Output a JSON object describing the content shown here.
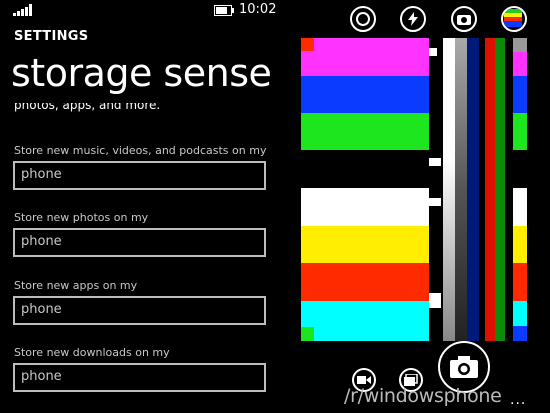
{
  "status_bar": {
    "time": "10:02",
    "signal_icon": "signal-bars-icon",
    "battery_icon": "battery-icon"
  },
  "settings": {
    "app_title": "SETTINGS",
    "page_title": "storage sense",
    "intro_text": "photos, apps, and more.",
    "options": [
      {
        "label": "Store new music, videos, and podcasts on my",
        "value": "phone"
      },
      {
        "label": "Store new photos on my",
        "value": "phone"
      },
      {
        "label": "Store new apps on my",
        "value": "phone"
      },
      {
        "label": "Store new downloads on my",
        "value": "phone"
      }
    ]
  },
  "camera": {
    "top_buttons": [
      "lens-icon",
      "flash-icon",
      "front-camera-icon",
      "color-effects-icon"
    ],
    "bottom_buttons": [
      "video-icon",
      "photo-roll-icon",
      "shutter-camera-icon"
    ],
    "watermark": "/r/windowsphone",
    "more_menu": "..."
  }
}
